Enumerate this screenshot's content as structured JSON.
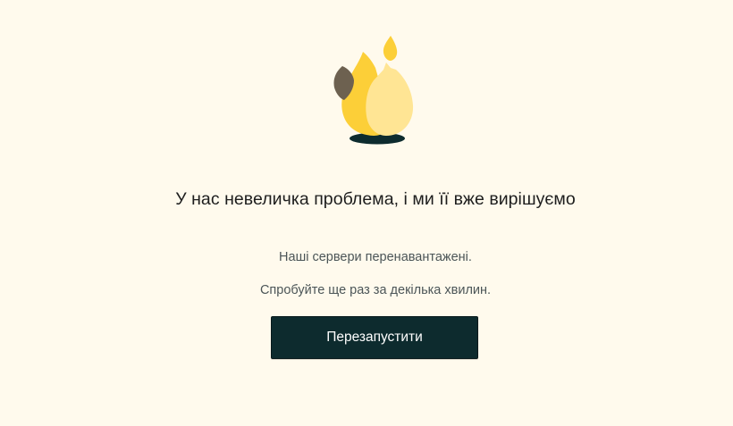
{
  "error": {
    "illustration_icon": "flame-icon",
    "title": "У нас невеличка проблема, і ми її вже вирішуємо",
    "message_line_1": "Наші сервери перенавантажені.",
    "message_line_2": "Спробуйте ще раз за декілька хвилин.",
    "restart_label": "Перезапустити"
  },
  "colors": {
    "background": "#fffaed",
    "flame_primary": "#fccf38",
    "flame_light": "#ffe594",
    "leaf": "#6d6150",
    "shadow": "#0d2b2e",
    "button": "#0d2b2e"
  }
}
